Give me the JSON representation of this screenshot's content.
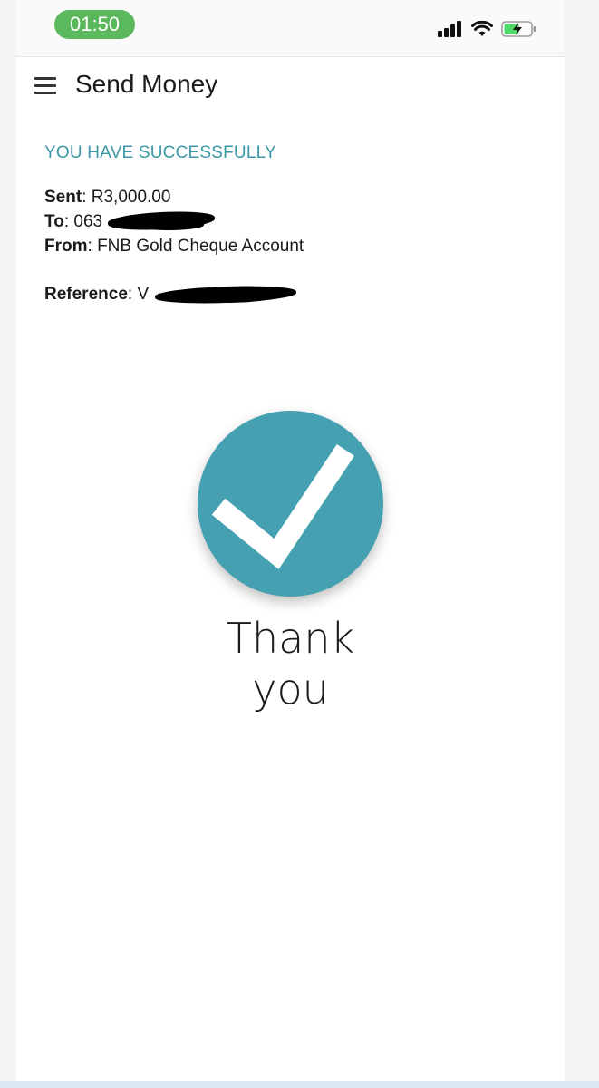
{
  "status_bar": {
    "time": "01:50",
    "icons": [
      "cellular-signal-icon",
      "wifi-icon",
      "battery-charging-icon"
    ],
    "pill_color": "#5cb85c"
  },
  "header": {
    "title": "Send Money",
    "menu_icon": "hamburger-menu-icon"
  },
  "confirmation": {
    "heading": "YOU HAVE SUCCESSFULLY",
    "sent_label": "Sent",
    "sent_value": "R3,000.00",
    "to_label": "To",
    "to_value": "063",
    "from_label": "From",
    "from_value": "FNB Gold Cheque Account",
    "reference_label": "Reference",
    "reference_value": "V"
  },
  "success_icon": {
    "name": "checkmark-icon",
    "color": "#45a1b1"
  },
  "thank_you": {
    "line1": "Thank",
    "line2": "you"
  },
  "colors": {
    "accent": "#3c97a6",
    "check_circle": "#45a1b1"
  }
}
